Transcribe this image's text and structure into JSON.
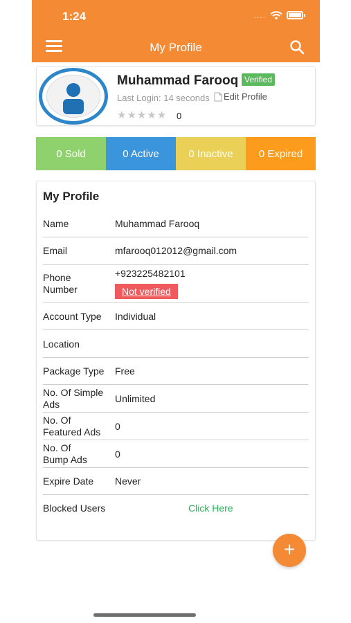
{
  "status_bar": {
    "time": "1:24",
    "signal": "....",
    "icons": [
      "wifi-icon",
      "battery-icon"
    ]
  },
  "header": {
    "title": "My Profile",
    "menu_icon": "hamburger-menu-icon",
    "search_icon": "search-icon",
    "color": "#f58a35"
  },
  "profile": {
    "name": "Muhammad Farooq",
    "verified_label": "Verified",
    "last_login": "Last Login: 14 seconds",
    "edit_label": "Edit Profile",
    "stars": "★★★★★",
    "rating_count": "0"
  },
  "stats": [
    {
      "label": "0 Sold",
      "color": "#8fd16d"
    },
    {
      "label": "0 Active",
      "color": "#3a95dd"
    },
    {
      "label": "0 Inactive",
      "color": "#ead057"
    },
    {
      "label": "0 Expired",
      "color": "#fd9b1c"
    }
  ],
  "details": {
    "title": "My Profile",
    "rows": [
      {
        "label": "Name",
        "value": "Muhammad Farooq"
      },
      {
        "label": "Email",
        "value": "mfarooq012012@gmail.com"
      },
      {
        "label": "Phone Number",
        "value": "+923225482101",
        "status": "Not verified"
      },
      {
        "label": "Account Type",
        "value": "Individual"
      },
      {
        "label": "Location",
        "value": ""
      },
      {
        "label": "Package Type",
        "value": "Free"
      },
      {
        "label": "No. Of Simple Ads",
        "value": "Unlimited"
      },
      {
        "label": "No. Of Featured Ads",
        "value": "0"
      },
      {
        "label": "No. Of Bump Ads",
        "value": "0"
      },
      {
        "label": "Expire Date",
        "value": "Never"
      },
      {
        "label": "Blocked Users",
        "link": "Click Here"
      }
    ]
  },
  "fab": {
    "label": "+"
  }
}
